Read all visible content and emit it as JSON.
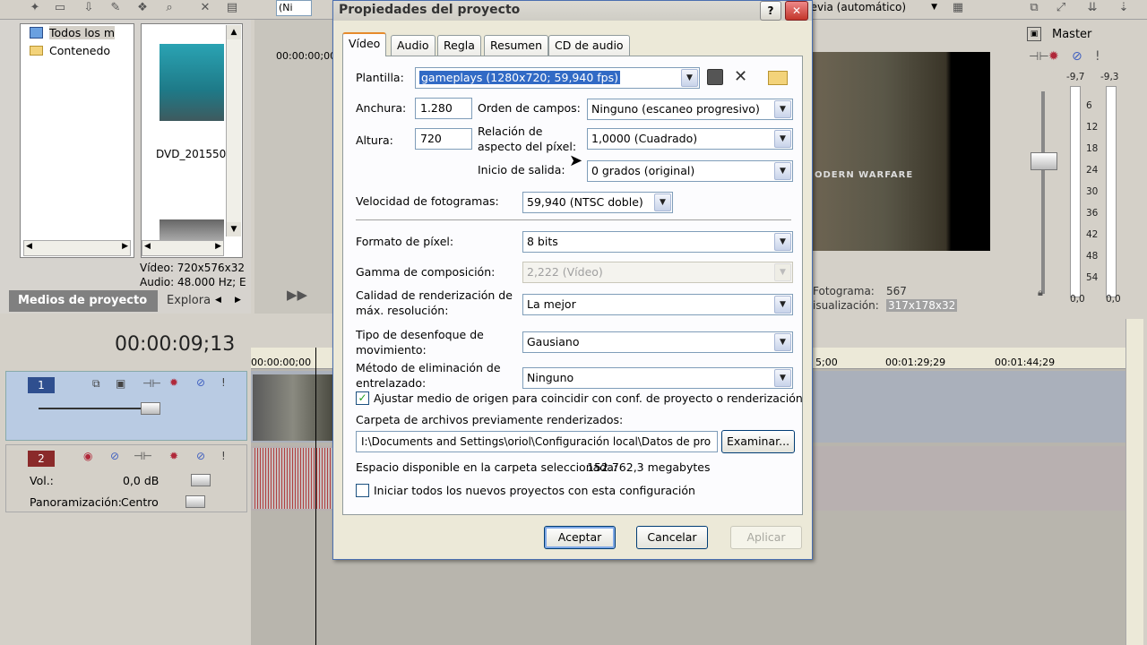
{
  "dialog": {
    "title": "Propiedades del proyecto",
    "tabs": [
      "Vídeo",
      "Audio",
      "Regla",
      "Resumen",
      "CD de audio"
    ],
    "template_label": "Plantilla:",
    "template_value": "gameplays (1280x720; 59,940 fps)",
    "width_label": "Anchura:",
    "width_value": "1.280",
    "height_label": "Altura:",
    "height_value": "720",
    "field_order_label": "Orden de campos:",
    "field_order_value": "Ninguno (escaneo progresivo)",
    "aspect_label_1": "Relación de",
    "aspect_label_2": "aspecto del píxel:",
    "aspect_value": "1,0000 (Cuadrado)",
    "rotation_label": "Inicio de salida:",
    "rotation_value": "0 grados (original)",
    "framerate_label": "Velocidad de fotogramas:",
    "framerate_value": "59,940 (NTSC doble)",
    "pixel_format_label": "Formato de píxel:",
    "pixel_format_value": "8 bits",
    "gamma_label": "Gamma de composición:",
    "gamma_value": "2,222 (Vídeo)",
    "quality_label_1": "Calidad de renderización de",
    "quality_label_2": "máx. resolución:",
    "quality_value": "La mejor",
    "blur_label_1": "Tipo de desenfoque de",
    "blur_label_2": "movimiento:",
    "blur_value": "Gausiano",
    "deint_label_1": "Método de eliminación de",
    "deint_label_2": "entrelazado:",
    "deint_value": "Ninguno",
    "adjust_checkbox_label": "Ajustar medio de origen para coincidir con conf. de proyecto o renderización",
    "adjust_checked": true,
    "folder_label": "Carpeta de archivos previamente renderizados:",
    "folder_value": "I:\\Documents and Settings\\oriol\\Configuración local\\Datos de pro",
    "browse_label": "Examinar...",
    "space_label": "Espacio disponible en la carpeta seleccionada:",
    "space_value": "152.762,3 megabytes",
    "start_all_label": "Iniciar todos los nuevos proyectos con esta configuración",
    "start_all_checked": false,
    "ok_label": "Aceptar",
    "cancel_label": "Cancelar",
    "apply_label": "Aplicar",
    "help_label": "?",
    "close_label": "✕"
  },
  "explorer": {
    "tree_items": [
      "Todos los m",
      "Contenedo"
    ],
    "clip_name": "DVD_201550",
    "video_info": "Vídeo: 720x576x32",
    "audio_info": "Audio: 48.000 Hz; E",
    "tab_media": "Medios de proyecto",
    "tab_explorer": "Explora"
  },
  "top": {
    "combo_left": "(Ni",
    "preview_combo": "revia (automático)"
  },
  "preview": {
    "overlay_text": "ODERN WARFARE",
    "frame_label": "Fotograma:",
    "frame_value": "567",
    "display_label": "isualización:",
    "display_value": "317x178x32"
  },
  "mixer": {
    "title": "Master",
    "peak_left": "-9,7",
    "peak_right": "-9,3",
    "scale": [
      "6",
      "12",
      "18",
      "24",
      "30",
      "36",
      "42",
      "48",
      "54"
    ],
    "bottom_left": "0,0",
    "bottom_right": "0,0"
  },
  "timeline": {
    "timecode": "00:00:09;13",
    "ruler_start": "00:00:00;00",
    "ruler_marks": [
      "5;00",
      "00:01:29;29",
      "00:01:44;29"
    ],
    "top_ruler": "00:00:00;00",
    "track1_number": "1",
    "track2_number": "2",
    "vol_label": "Vol.:",
    "vol_value": "0,0 dB",
    "pan_label": "Panoramización:",
    "pan_value": "Centro"
  }
}
